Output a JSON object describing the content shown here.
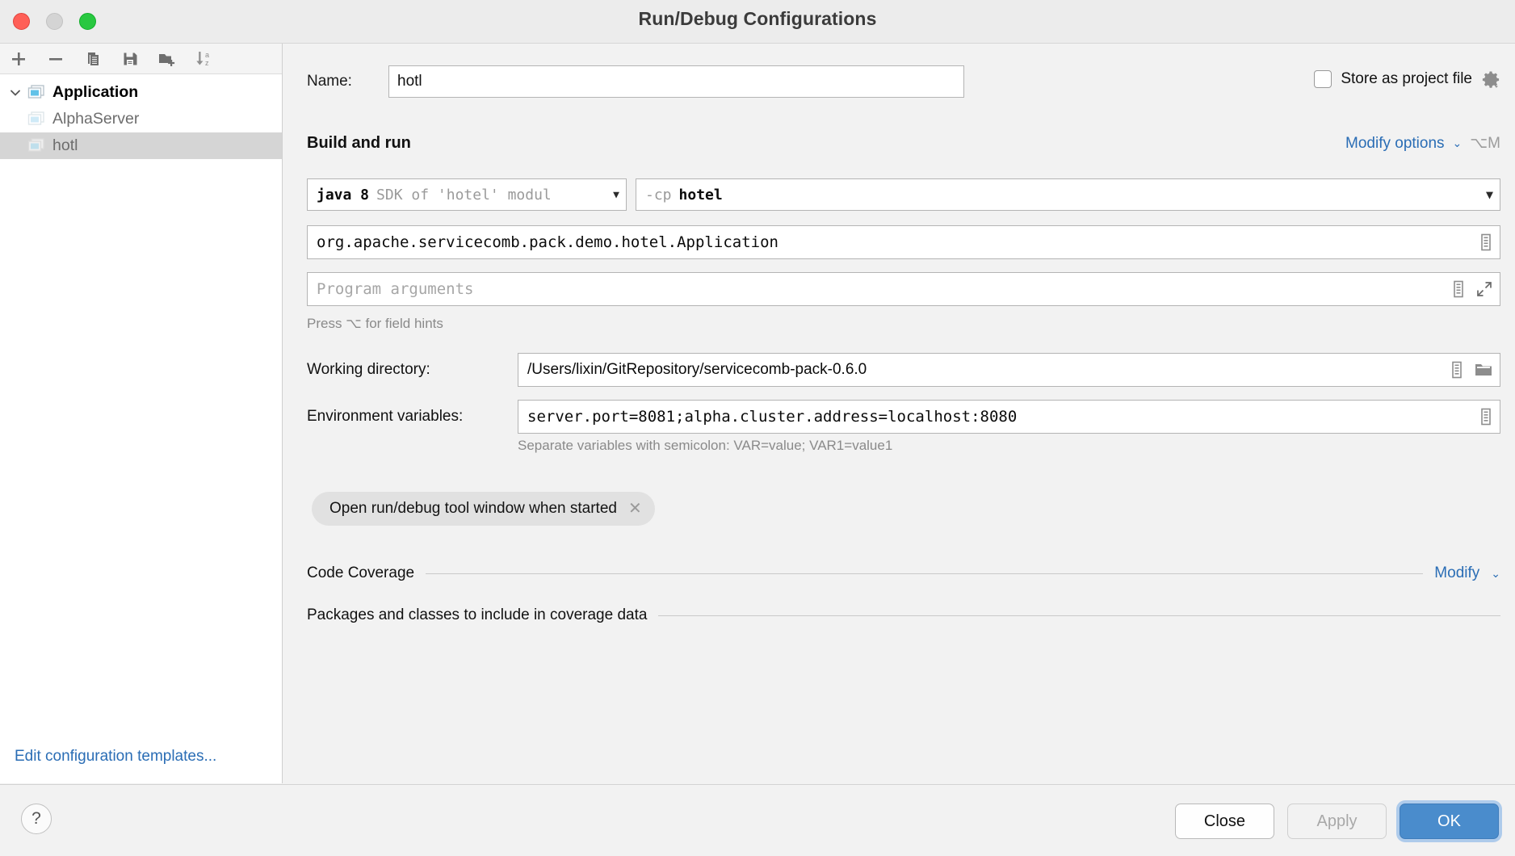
{
  "window": {
    "title": "Run/Debug Configurations",
    "traffic_lights": [
      "close",
      "minimize",
      "zoom"
    ]
  },
  "toolbar": {
    "buttons": [
      {
        "name": "add",
        "icon": "plus-icon"
      },
      {
        "name": "remove",
        "icon": "minus-icon"
      },
      {
        "name": "copy",
        "icon": "copy-icon"
      },
      {
        "name": "save",
        "icon": "save-icon"
      },
      {
        "name": "move-to-folder",
        "icon": "folder-add-icon"
      },
      {
        "name": "sort-alphabetically",
        "icon": "sort-az-icon"
      }
    ]
  },
  "sidebar": {
    "tree": [
      {
        "label": "Application",
        "level": 0,
        "expanded": true,
        "selected": false,
        "bold": true
      },
      {
        "label": "AlphaServer",
        "level": 1,
        "expanded": false,
        "selected": false,
        "bold": false
      },
      {
        "label": "hotl",
        "level": 1,
        "expanded": false,
        "selected": true,
        "bold": false
      }
    ],
    "edit_templates_link": "Edit configuration templates..."
  },
  "form": {
    "name_label": "Name:",
    "name_value": "hotl",
    "store_as_project_file": {
      "label": "Store as project file",
      "checked": false,
      "gear_icon": "gear-icon"
    },
    "build_and_run": {
      "title": "Build and run",
      "modify_options_link": "Modify options",
      "modify_options_shortcut": "⌥M",
      "jdk": {
        "primary": "java 8",
        "secondary": "SDK of 'hotel' modul"
      },
      "classpath": {
        "prefix": "-cp",
        "value": "hotel"
      },
      "main_class": "org.apache.servicecomb.pack.demo.hotel.Application",
      "program_arguments_placeholder": "Program arguments",
      "field_hint": "Press ⌥ for field hints"
    },
    "working_directory": {
      "label": "Working directory:",
      "value": "/Users/lixin/GitRepository/servicecomb-pack-0.6.0"
    },
    "environment_variables": {
      "label": "Environment variables:",
      "value": "server.port=8081;alpha.cluster.address=localhost:8080",
      "hint": "Separate variables with semicolon: VAR=value; VAR1=value1"
    },
    "chip": {
      "label": "Open run/debug tool window when started",
      "close_icon": "close-icon"
    },
    "code_coverage": {
      "title": "Code Coverage",
      "modify_link": "Modify",
      "subtitle": "Packages and classes to include in coverage data"
    }
  },
  "footer": {
    "help_label": "?",
    "close_label": "Close",
    "apply_label": "Apply",
    "ok_label": "OK"
  },
  "colors": {
    "accent_link": "#2a6db5",
    "primary_button": "#4a8ccc",
    "selection": "#d5d5d5"
  }
}
